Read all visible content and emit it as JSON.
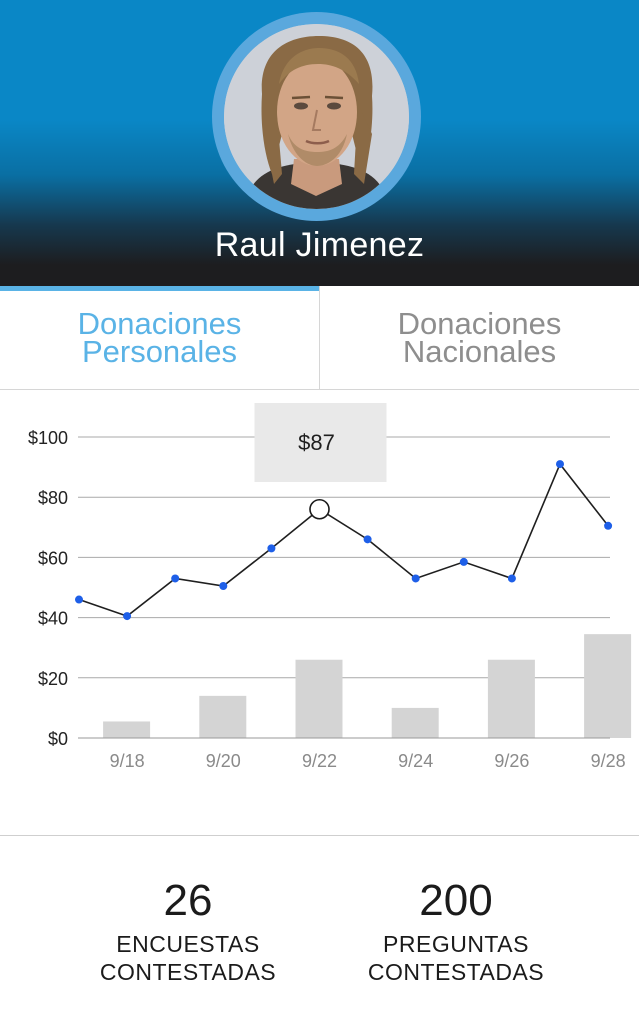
{
  "profile": {
    "name": "Raul Jimenez",
    "avatar_icon": "user-portrait"
  },
  "tabs": [
    {
      "label": "Donaciones\nPersonales",
      "active": true
    },
    {
      "label": "Donaciones\nNacionales",
      "active": false
    }
  ],
  "colors": {
    "header_blue": "#0a87c6",
    "accent": "#5ab3e6",
    "line": "#1f1f1f",
    "point": "#1e5fe8",
    "bar": "#d4d4d4",
    "tooltip_bg": "#e9e9e9"
  },
  "chart_data": {
    "type": "line",
    "y_ticks": [
      "$100",
      "$80",
      "$60",
      "$40",
      "$20",
      "$0"
    ],
    "ylim": [
      0,
      100
    ],
    "x_tick_labels": [
      "9/18",
      "9/20",
      "9/22",
      "9/24",
      "9/26",
      "9/28"
    ],
    "line_series": {
      "x": [
        "9/17",
        "9/18",
        "9/19",
        "9/20",
        "9/21",
        "9/22",
        "9/23",
        "9/24",
        "9/25",
        "9/26",
        "9/27",
        "9/28"
      ],
      "values": [
        46,
        40.5,
        53,
        50.5,
        63,
        76,
        66,
        53,
        58.5,
        53,
        91,
        70.5
      ]
    },
    "bar_series": {
      "x": [
        "9/18",
        "9/20",
        "9/22",
        "9/24",
        "9/26",
        "9/28"
      ],
      "values": [
        5.5,
        14,
        26,
        10,
        26,
        34.5
      ]
    },
    "tooltip": {
      "label": "$87",
      "x": "9/22"
    },
    "highlight_x": "9/22",
    "grid": true,
    "legend": false
  },
  "stats": [
    {
      "value": "26",
      "label": "ENCUESTAS\nCONTESTADAS"
    },
    {
      "value": "200",
      "label": "PREGUNTAS\nCONTESTADAS"
    }
  ]
}
